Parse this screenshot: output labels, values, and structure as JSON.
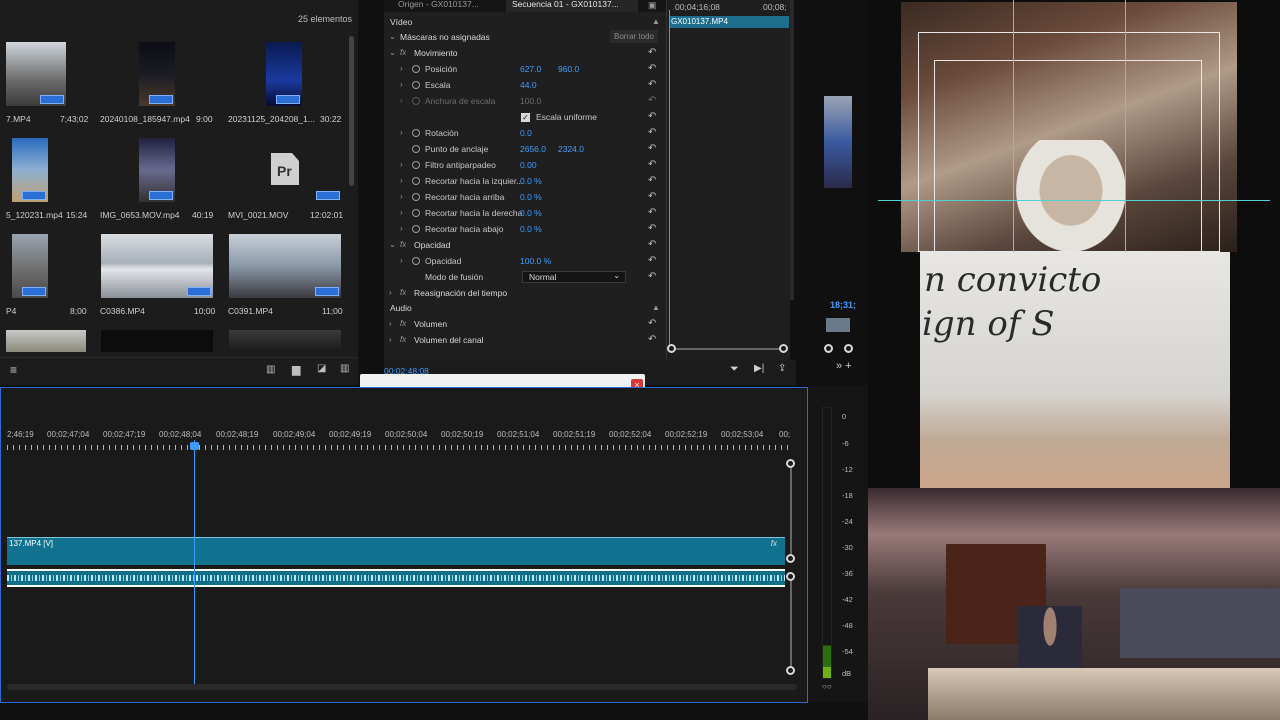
{
  "project": {
    "count_label": "25 elementos",
    "clips": [
      {
        "name": "7.MP4",
        "duration": "7;43;02"
      },
      {
        "name": "20240108_185947.mp4",
        "duration": "9:00"
      },
      {
        "name": "20231125_204208_1...",
        "duration": "30:22"
      },
      {
        "name": "5_120231.mp4",
        "duration": "15:24"
      },
      {
        "name": "IMG_0653.MOV.mp4",
        "duration": "40:19"
      },
      {
        "name": "MVI_0021.MOV",
        "duration": "12:02:01"
      },
      {
        "name": "P4",
        "duration": "8;00"
      },
      {
        "name": "C0386.MP4",
        "duration": "10;00"
      },
      {
        "name": "C0391.MP4",
        "duration": "11;00"
      }
    ],
    "pr_badge": "Pr"
  },
  "effect_controls": {
    "tabs": [
      "Origen - GX010137...",
      "Secuencia 01 - GX010137..."
    ],
    "time_left": "00;04;16;08",
    "time_right": "00;08;",
    "video_header": "Vídeo",
    "masks_label": "Máscaras no asignadas",
    "clear_all": "Borrar todo",
    "motion": "Movimiento",
    "position_label": "Posición",
    "position_x": "627.0",
    "position_y": "960.0",
    "scale_label": "Escala",
    "scale_value": "44.0",
    "scale_width_label": "Anchura de escala",
    "scale_width_value": "100.0",
    "uniform_scale": "Escala uniforme",
    "rotation_label": "Rotación",
    "rotation_value": "0.0",
    "anchor_label": "Punto de anclaje",
    "anchor_x": "2656.0",
    "anchor_y": "2324.0",
    "flicker_label": "Filtro antiparpadeo",
    "flicker_value": "0.00",
    "crop_left_label": "Recortar hacia la izquier...",
    "crop_left_value": "0.0 %",
    "crop_top_label": "Recortar hacia arriba",
    "crop_top_value": "0.0 %",
    "crop_right_label": "Recortar hacia la derecha",
    "crop_right_value": "0.0 %",
    "crop_bottom_label": "Recortar hacia abajo",
    "crop_bottom_value": "0.0 %",
    "opacity_section": "Opacidad",
    "opacity_label": "Opacidad",
    "opacity_value": "100.0 %",
    "blend_label": "Modo de fusión",
    "blend_value": "Normal",
    "time_remap": "Reasignación del tiempo",
    "audio_header": "Audio",
    "volume": "Volumen",
    "channel_volume": "Volumen del canal",
    "footer_timecode": "00;02;48;08",
    "clip_name": "GX010137.MP4"
  },
  "source_monitor": {
    "timecode": "18;31;"
  },
  "timeline": {
    "ruler_labels": [
      "2;46;19",
      "00;02;47;04",
      "00;02;47;19",
      "00;02;48;04",
      "00;02;48;19",
      "00;02;49;04",
      "00;02;49;19",
      "00;02;50;04",
      "00;02;50;19",
      "00;02;51;04",
      "00;02;51;19",
      "00;02;52;04",
      "00;02;52;19",
      "00;02;53;04",
      "00;"
    ],
    "video_clip": "137.MP4 [V]",
    "fx_marker": "fx"
  },
  "meters": {
    "db_labels": [
      "0",
      "-6",
      "-12",
      "-18",
      "-24",
      "-30",
      "-36",
      "-42",
      "-48",
      "-54",
      "dB"
    ]
  },
  "overlay": {
    "whiteboard_text_line1": "n convicto",
    "whiteboard_text_line2": "ign of S"
  },
  "tools": {
    "icons": [
      "selection-tool",
      "track-select-tool",
      "ripple-edit-tool",
      "razor-tool",
      "slip-tool",
      "pen-tool",
      "rectangle-tool",
      "hand-tool",
      "hand-tool-2",
      "type-tool",
      "auto-reframe-tool"
    ]
  }
}
